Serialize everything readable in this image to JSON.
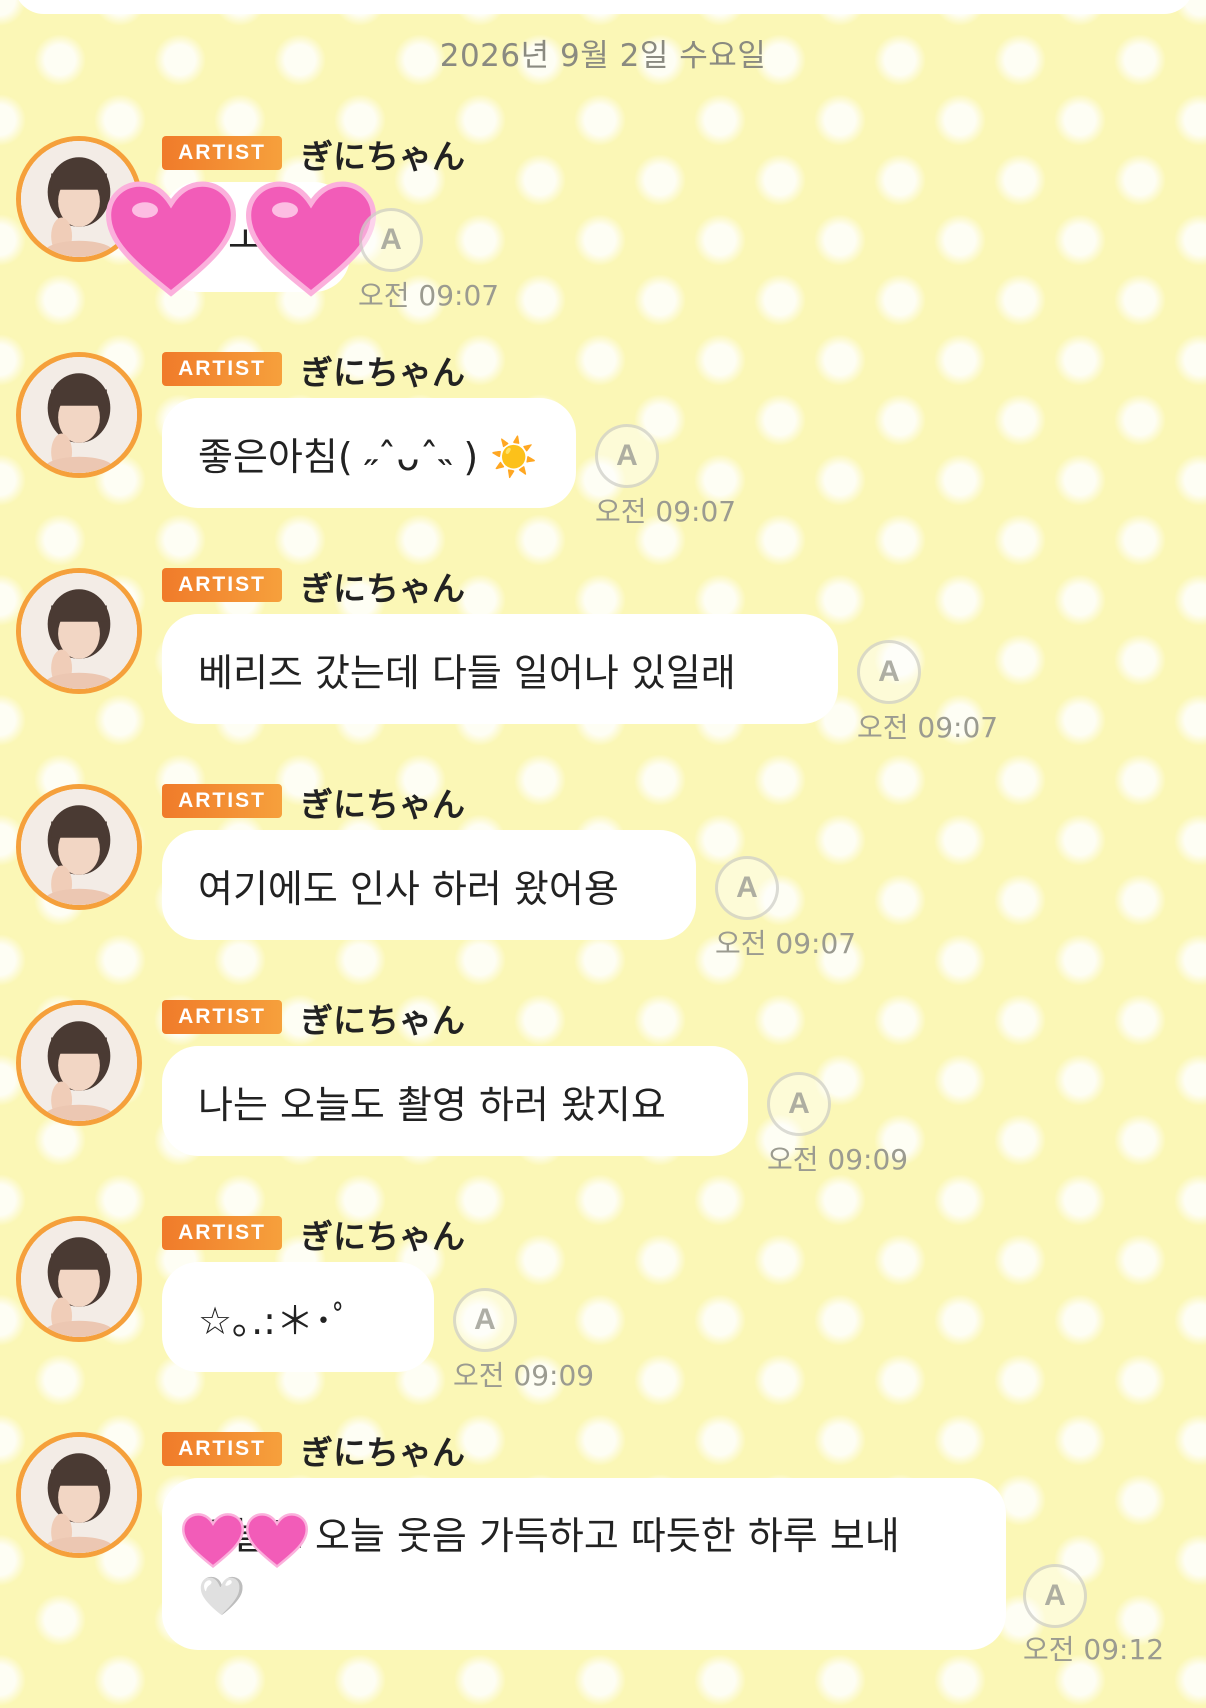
{
  "date_header": "2026년 9월 2일 수요일",
  "messages": [
    {
      "badge": "ARTIST",
      "sender": "ぎにちゃん",
      "text": "ㅗ이",
      "time": "오전 09:07",
      "translate_icon": "A"
    },
    {
      "badge": "ARTIST",
      "sender": "ぎにちゃん",
      "text": "좋은아침( ˶ˆᴗˆ˵ ) ☀️",
      "time": "오전 09:07",
      "translate_icon": "A"
    },
    {
      "badge": "ARTIST",
      "sender": "ぎにちゃん",
      "text": "베리즈 갔는데 다들 일어나 있일래",
      "time": "오전 09:07",
      "translate_icon": "A"
    },
    {
      "badge": "ARTIST",
      "sender": "ぎにちゃん",
      "text": "여기에도 인사 하러 왔어용",
      "time": "오전 09:07",
      "translate_icon": "A"
    },
    {
      "badge": "ARTIST",
      "sender": "ぎにちゃん",
      "text": "나는 오늘도 촬영 하러 왔지요",
      "time": "오전 09:09",
      "translate_icon": "A"
    },
    {
      "badge": "ARTIST",
      "sender": "ぎにちゃん",
      "text": "☆｡.:＊･ﾟ",
      "time": "오전 09:09",
      "translate_icon": "A"
    },
    {
      "badge": "ARTIST",
      "sender": "ぎにちゃん",
      "text": "오늘도 오늘 웃음 가득하고 따듯한 하루 보내",
      "text_line2": "🤍",
      "time": "오전 09:12",
      "translate_icon": "A"
    }
  ],
  "colors": {
    "accent": "#f5a03b",
    "badge": "#f07b2a",
    "background": "#fbf7b6",
    "heart": "#f25cb8"
  },
  "icons": [
    "heart-sticker-icon",
    "translate-icon",
    "white-heart-icon",
    "sun-icon"
  ]
}
